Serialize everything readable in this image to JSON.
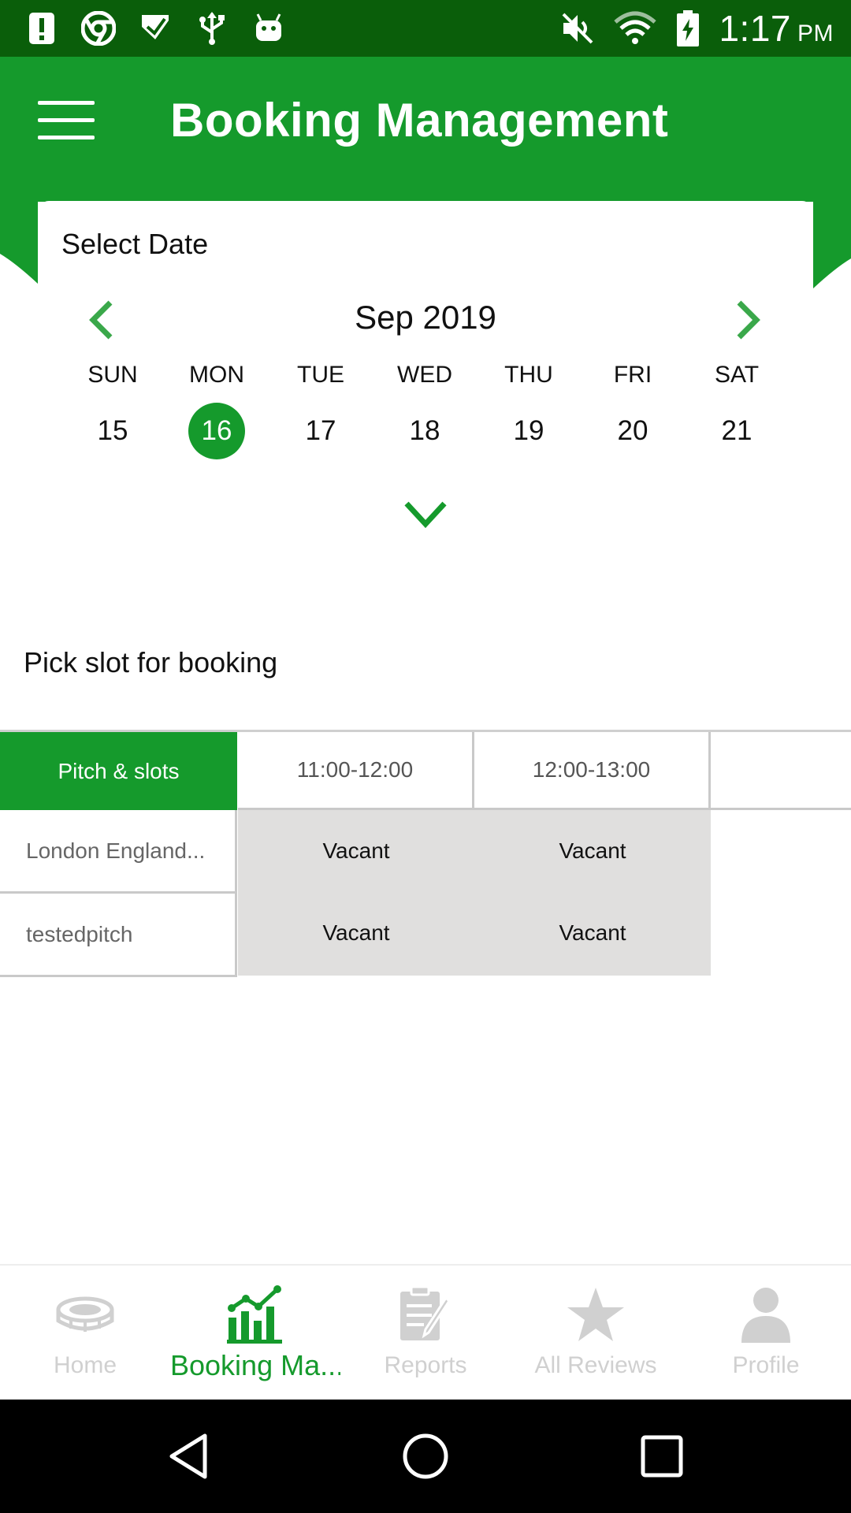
{
  "status_bar": {
    "time": "1:17",
    "am_pm": "PM",
    "left_icons": [
      "alert-icon",
      "chrome-icon",
      "tick-app-icon",
      "usb-icon",
      "android-icon"
    ],
    "right_icons": [
      "mute-icon",
      "wifi-icon",
      "battery-charging-icon"
    ]
  },
  "app_bar": {
    "title": "Booking Management",
    "menu_icon": "hamburger-menu-icon"
  },
  "date_picker": {
    "label": "Select Date",
    "month": "Sep 2019",
    "weekdays": [
      "SUN",
      "MON",
      "TUE",
      "WED",
      "THU",
      "FRI",
      "SAT"
    ],
    "days": [
      "15",
      "16",
      "17",
      "18",
      "19",
      "20",
      "21"
    ],
    "selected_day": "16",
    "prev_icon": "chevron-left-icon",
    "next_icon": "chevron-right-icon",
    "expand_icon": "chevron-down-icon"
  },
  "slots": {
    "title": "Pick slot for booking",
    "header": "Pitch & slots",
    "times": [
      "11:00-12:00",
      "12:00-13:00"
    ],
    "rows": [
      {
        "pitch": "London England...",
        "cells": [
          "Vacant",
          "Vacant"
        ]
      },
      {
        "pitch": "testedpitch",
        "cells": [
          "Vacant",
          "Vacant"
        ]
      }
    ]
  },
  "bottom_nav": [
    {
      "label": "Home",
      "icon": "stadium-icon",
      "active": false
    },
    {
      "label": "Booking Ma...",
      "icon": "bar-chart-icon",
      "active": true
    },
    {
      "label": "Reports",
      "icon": "report-clipboard-icon",
      "active": false
    },
    {
      "label": "All Reviews",
      "icon": "star-icon",
      "active": false
    },
    {
      "label": "Profile",
      "icon": "person-icon",
      "active": false
    }
  ],
  "system_nav": {
    "back_icon": "back-triangle-icon",
    "home_icon": "home-circle-icon",
    "recents_icon": "recents-square-icon"
  },
  "colors": {
    "primary": "#159a2c",
    "status_bar": "#0a5e0a",
    "vacant_cell": "#e0dfde",
    "inactive_nav": "#d0d0d0"
  }
}
